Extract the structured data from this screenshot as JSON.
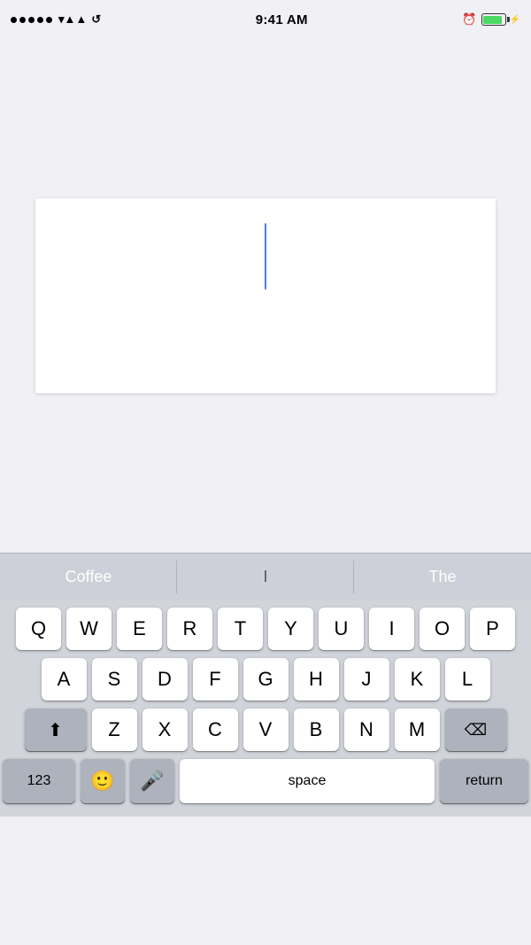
{
  "statusBar": {
    "time": "9:41 AM",
    "signalDots": 5,
    "hasWifi": true,
    "hasSync": true,
    "hasAlarm": true
  },
  "autocomplete": {
    "left": "Coffee",
    "middle": "I",
    "right": "The"
  },
  "keyboard": {
    "rows": [
      [
        "Q",
        "W",
        "E",
        "R",
        "T",
        "Y",
        "U",
        "I",
        "O",
        "P"
      ],
      [
        "A",
        "S",
        "D",
        "F",
        "G",
        "H",
        "J",
        "K",
        "L"
      ],
      [
        "Z",
        "X",
        "C",
        "V",
        "B",
        "N",
        "M"
      ]
    ],
    "bottomRow": {
      "numbers": "123",
      "space": "space",
      "return": "return"
    }
  }
}
